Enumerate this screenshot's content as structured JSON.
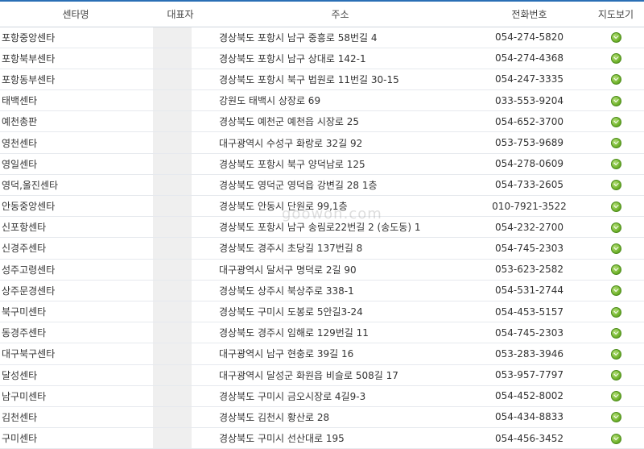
{
  "headers": {
    "name": "센타명",
    "rep": "대표자",
    "addr": "주소",
    "phone": "전화번호",
    "map": "지도보기"
  },
  "watermark": "goowon.com",
  "rows": [
    {
      "name": "포항중앙센타",
      "addr": "경상북도 포항시 남구 중흥로 58번길 4",
      "phone": "054-274-5820"
    },
    {
      "name": "포항북부센타",
      "addr": "경상북도 포항시 남구 상대로 142-1",
      "phone": "054-274-4368"
    },
    {
      "name": "포항동부센타",
      "addr": "경상북도 포항시 북구 법원로 11번길 30-15",
      "phone": "054-247-3335"
    },
    {
      "name": "태백센타",
      "addr": "강원도 태백시 상장로 69",
      "phone": "033-553-9204"
    },
    {
      "name": "예천총판",
      "addr": "경상북도 예천군 예천읍 시장로 25",
      "phone": "054-652-3700"
    },
    {
      "name": "영천센타",
      "addr": "대구광역시 수성구 화랑로 32길 92",
      "phone": "053-753-9689"
    },
    {
      "name": "영일센타",
      "addr": "경상북도 포항시 북구 양덕남로 125",
      "phone": "054-278-0609"
    },
    {
      "name": "영덕,울진센타",
      "addr": "경상북도 영덕군 영덕읍 강변길 28 1층",
      "phone": "054-733-2605"
    },
    {
      "name": "안동중앙센타",
      "addr": "경상북도 안동시 단원로 99,1층",
      "phone": "010-7921-3522"
    },
    {
      "name": "신포항센타",
      "addr": "경상북도 포항시 남구 송림로22번길 2 (송도동) 1",
      "phone": "054-232-2700"
    },
    {
      "name": "신경주센타",
      "addr": "경상북도 경주시 초당길 137번길 8",
      "phone": "054-745-2303"
    },
    {
      "name": "성주고령센타",
      "addr": "대구광역시 달서구 명덕로 2길 90",
      "phone": "053-623-2582"
    },
    {
      "name": "상주문경센타",
      "addr": "경상북도 상주시 북상주로 338-1",
      "phone": "054-531-2744"
    },
    {
      "name": "북구미센타",
      "addr": "경상북도 구미시 도봉로 5안길3-24",
      "phone": "054-453-5157"
    },
    {
      "name": "동경주센타",
      "addr": "경상북도 경주시 임해로 129번길 11",
      "phone": "054-745-2303"
    },
    {
      "name": "대구북구센타",
      "addr": "대구광역시 남구 현충로 39길 16",
      "phone": "053-283-3946"
    },
    {
      "name": "달성센타",
      "addr": "대구광역시 달성군 화원읍 비슬로 508길 17",
      "phone": "053-957-7797"
    },
    {
      "name": "남구미센타",
      "addr": "경상북도 구미시 금오시장로 4길9-3",
      "phone": "054-452-8002"
    },
    {
      "name": "김천센타",
      "addr": "경상북도 김천시 황산로 28",
      "phone": "054-434-8833"
    },
    {
      "name": "구미센타",
      "addr": "경상북도 구미시 선산대로 195",
      "phone": "054-456-3452"
    }
  ],
  "map_icon": "map-marker-icon",
  "colors": {
    "header_border": "#2a6fb5",
    "map_icon": "#73b52e"
  }
}
